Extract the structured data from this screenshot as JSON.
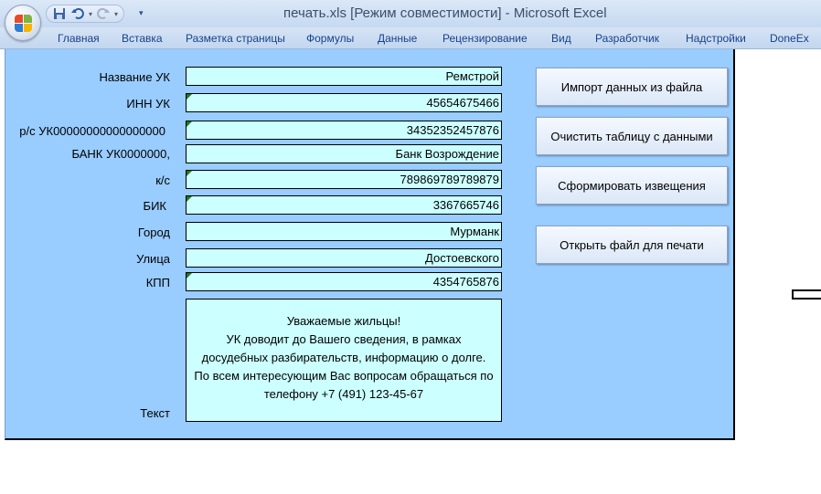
{
  "window": {
    "title": "печать.xls  [Режим совместимости] - Microsoft Excel"
  },
  "quick_access": {
    "items": [
      "save-icon",
      "undo-icon",
      "redo-icon",
      "customize-icon"
    ]
  },
  "ribbon": {
    "tabs": [
      "Главная",
      "Вставка",
      "Разметка страницы",
      "Формулы",
      "Данные",
      "Рецензирование",
      "Вид",
      "Разработчик",
      "Надстройки",
      "DoneEx"
    ]
  },
  "form": {
    "fields": [
      {
        "label": "Название УК",
        "value": "Ремстрой"
      },
      {
        "label": "ИНН  УК",
        "value": "45654675466"
      },
      {
        "label": "р/с УК00000000000000000",
        "value": "34352352457876"
      },
      {
        "label": "БАНК УК0000000,",
        "value": "Банк Возрождение"
      },
      {
        "label": "к/с",
        "value": "789869789789879"
      },
      {
        "label": "БИК",
        "value": "3367665746"
      },
      {
        "label": "Город",
        "value": "Мурманк"
      },
      {
        "label": "Улица",
        "value": "Достоевского"
      },
      {
        "label": "КПП",
        "value": "4354765876"
      }
    ],
    "text_label": "Текст",
    "text_lines": [
      "Уважаемые жильцы!",
      "УК доводит до Вашего сведения, в рамках",
      "досудебных разбирательств, информацию о долге.",
      "По всем интересующим Вас вопросам обращаться по",
      "телефону +7 (491) 123-45-67"
    ]
  },
  "buttons": {
    "import": "Импорт данных из файла",
    "clear": "Очистить таблицу с данными",
    "generate": "Сформировать извещения",
    "open_print": "Открыть файл для печати"
  },
  "colors": {
    "sheet_bg": "#99ccff",
    "field_bg": "#ccffff",
    "tab_text": "#15428b"
  }
}
